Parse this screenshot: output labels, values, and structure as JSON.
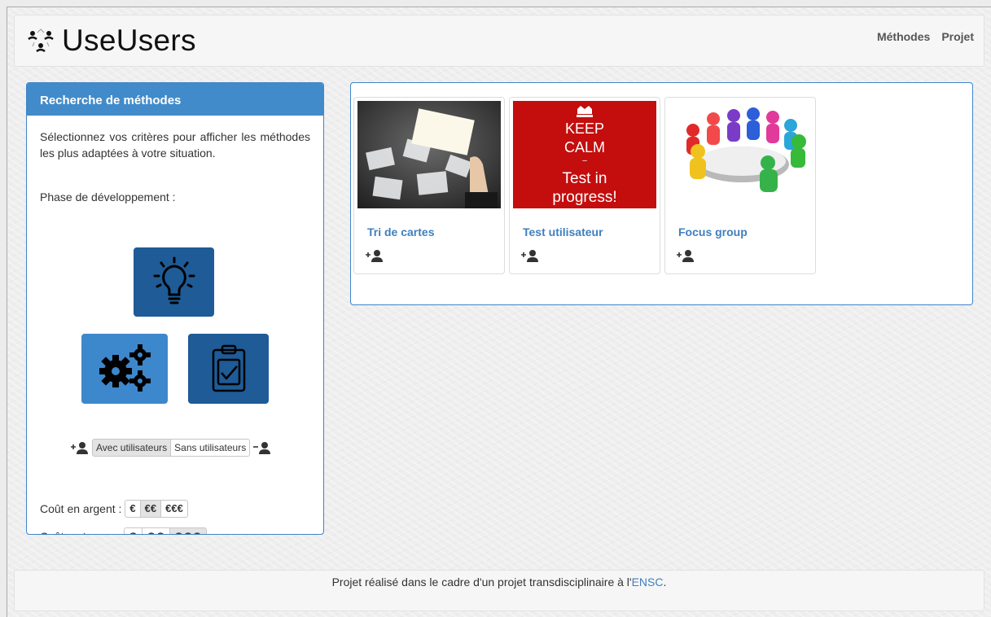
{
  "header": {
    "brand": "UseUsers",
    "nav": [
      "Méthodes",
      "Projet"
    ]
  },
  "search": {
    "title": "Recherche de méthodes",
    "intro": "Sélectionnez vos critères pour afficher les méthodes les plus adaptées à votre situation.",
    "phase_label": "Phase de développement :",
    "phases": [
      {
        "name": "idea",
        "icon": "lightbulb-icon",
        "selected": true
      },
      {
        "name": "development",
        "icon": "gears-icon",
        "selected": false
      },
      {
        "name": "evaluation",
        "icon": "clipboard-check-icon",
        "selected": true
      }
    ],
    "users": {
      "options": [
        "Avec utilisateurs",
        "Sans utilisateurs"
      ],
      "active": "Avec utilisateurs"
    },
    "money": {
      "label": "Coût en argent :",
      "options": [
        "€",
        "€€",
        "€€€"
      ],
      "active": "€€"
    },
    "time": {
      "label": "Coût en temps :",
      "options": [
        "◷",
        "◷◷",
        "◷◷◷"
      ],
      "active": "◷◷◷"
    }
  },
  "results": [
    {
      "name": "Tri de cartes",
      "users_icon": "add-user-icon"
    },
    {
      "name": "Test utilisateur",
      "users_icon": "add-user-icon",
      "image_text": [
        "KEEP",
        "CALM",
        "–",
        "Test in",
        "progress!"
      ]
    },
    {
      "name": "Focus group",
      "users_icon": "add-user-icon"
    }
  ],
  "footer": {
    "text": "Projet réalisé dans le cadre d'un projet transdisciplinaire à l'",
    "link": "ENSC",
    "end": "."
  },
  "colors": {
    "primary": "#428bca",
    "tile_dark": "#1e5b97",
    "tile_light": "#3d87cc",
    "link": "#3f7fbf"
  }
}
